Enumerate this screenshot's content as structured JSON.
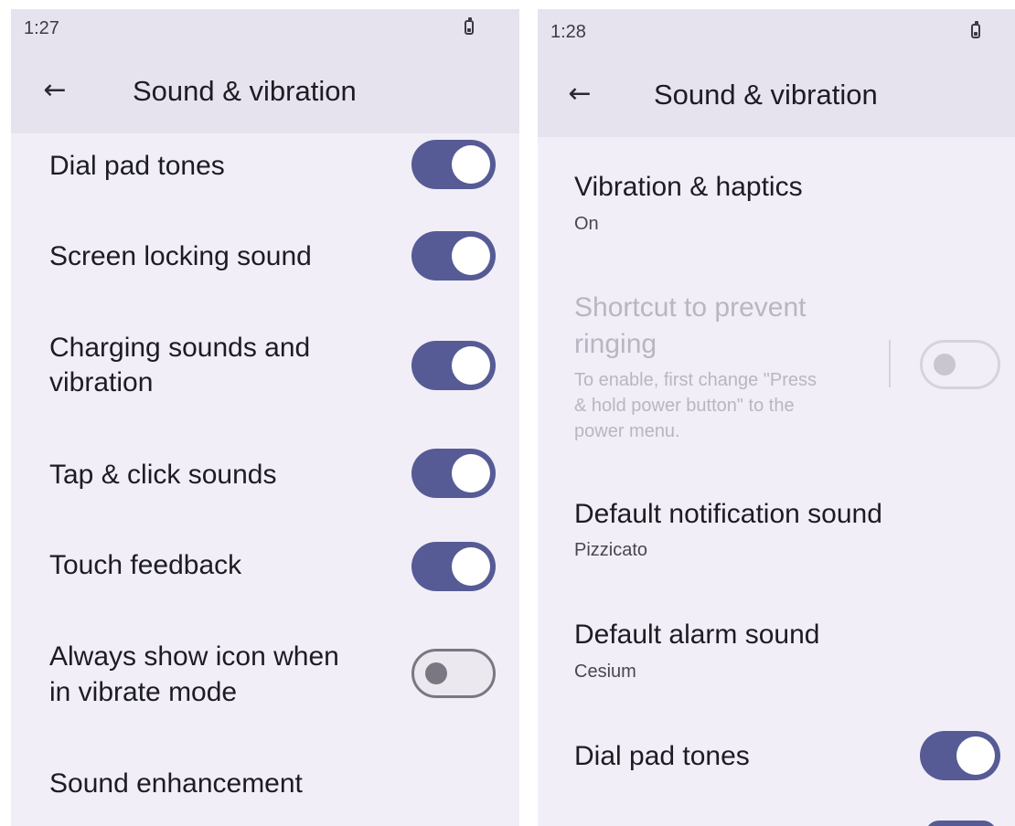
{
  "left": {
    "status": {
      "time": "1:27"
    },
    "header": {
      "back_icon": "arrow-back-icon",
      "title": "Sound & vibration"
    },
    "items": [
      {
        "label": "Dial pad tones",
        "toggle": "on"
      },
      {
        "label": "Screen locking sound",
        "toggle": "on"
      },
      {
        "label": "Charging sounds and",
        "label2": "vibration",
        "toggle": "on"
      },
      {
        "label": "Tap & click sounds",
        "toggle": "on"
      },
      {
        "label": "Touch feedback",
        "toggle": "on"
      },
      {
        "label": "Always show icon when",
        "label2": "in vibrate mode",
        "toggle": "off"
      },
      {
        "label": "Sound enhancement"
      }
    ]
  },
  "right": {
    "status": {
      "time": "1:28"
    },
    "header": {
      "back_icon": "arrow-back-icon",
      "title": "Sound & vibration"
    },
    "vibration": {
      "label": "Vibration & haptics",
      "summary": "On"
    },
    "shortcut": {
      "label1": "Shortcut to prevent",
      "label2": "ringing",
      "desc1": "To enable, first change \"Press",
      "desc2": "& hold power button\" to the",
      "desc3": "power menu.",
      "toggle": "disabled"
    },
    "notification": {
      "label": "Default notification sound",
      "summary": "Pizzicato"
    },
    "alarm": {
      "label": "Default alarm sound",
      "summary": "Cesium"
    },
    "dialpad": {
      "label": "Dial pad tones",
      "toggle": "on"
    }
  },
  "colors": {
    "toggle_on": "#565b95",
    "background": "#f1eef7",
    "appbar": "#e6e3ee",
    "disabled_text": "#b9b6c2"
  }
}
